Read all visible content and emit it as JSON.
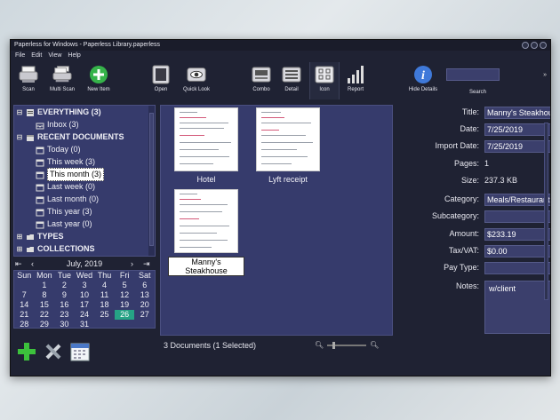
{
  "window": {
    "title": "Paperless for Windows - Paperless Library.paperless"
  },
  "menu": [
    "File",
    "Edit",
    "View",
    "Help"
  ],
  "toolbar": {
    "scan": "Scan",
    "multi_scan": "Multi Scan",
    "new_item": "New Item",
    "open": "Open",
    "quick_look": "Quick Look",
    "combo": "Combo",
    "detail": "Detail",
    "icon": "Icon",
    "report": "Report",
    "hide_details": "Hide Details",
    "search": "Search"
  },
  "tree": {
    "everything": "EVERYTHING (3)",
    "inbox": "Inbox (3)",
    "recent": "RECENT DOCUMENTS",
    "today": "Today (0)",
    "this_week": "This week (3)",
    "this_month": "This month (3)",
    "last_week": "Last week (0)",
    "last_month": "Last month (0)",
    "this_year": "This year (3)",
    "last_year": "Last year (0)",
    "types": "TYPES",
    "collections": "COLLECTIONS"
  },
  "calendar": {
    "month": "July, 2019",
    "days_of_week": [
      "Sun",
      "Mon",
      "Tue",
      "Wed",
      "Thu",
      "Fri",
      "Sat"
    ],
    "weeks": [
      [
        "",
        "1",
        "2",
        "3",
        "4",
        "5",
        "6"
      ],
      [
        "7",
        "8",
        "9",
        "10",
        "11",
        "12",
        "13"
      ],
      [
        "14",
        "15",
        "16",
        "17",
        "18",
        "19",
        "20"
      ],
      [
        "21",
        "22",
        "23",
        "24",
        "25",
        "26",
        "27"
      ],
      [
        "28",
        "29",
        "30",
        "31",
        "",
        "",
        ""
      ]
    ],
    "highlighted": "26"
  },
  "documents": [
    {
      "name": "Hotel"
    },
    {
      "name": "Lyft receipt"
    },
    {
      "name": "Manny's Steakhouse",
      "selected": true
    }
  ],
  "status": "3 Documents (1 Selected)",
  "properties": {
    "title_label": "Title:",
    "title": "Manny's Steakhou",
    "date_label": "Date:",
    "date": "7/25/2019",
    "import_label": "Import Date:",
    "import_date": "7/25/2019",
    "pages_label": "Pages:",
    "pages": "1",
    "size_label": "Size:",
    "size": "237.3 KB",
    "category_label": "Category:",
    "category": "Meals/Restaurant",
    "subcategory_label": "Subcategory:",
    "subcategory": "",
    "amount_label": "Amount:",
    "amount": "$233.19",
    "tax_label": "Tax/VAT:",
    "tax": "$0.00",
    "paytype_label": "Pay Type:",
    "paytype": "",
    "notes_label": "Notes:",
    "notes": "w/client"
  },
  "colors": {
    "panel": "#363b6c",
    "window": "#1f2233",
    "accent": "#26a385"
  }
}
